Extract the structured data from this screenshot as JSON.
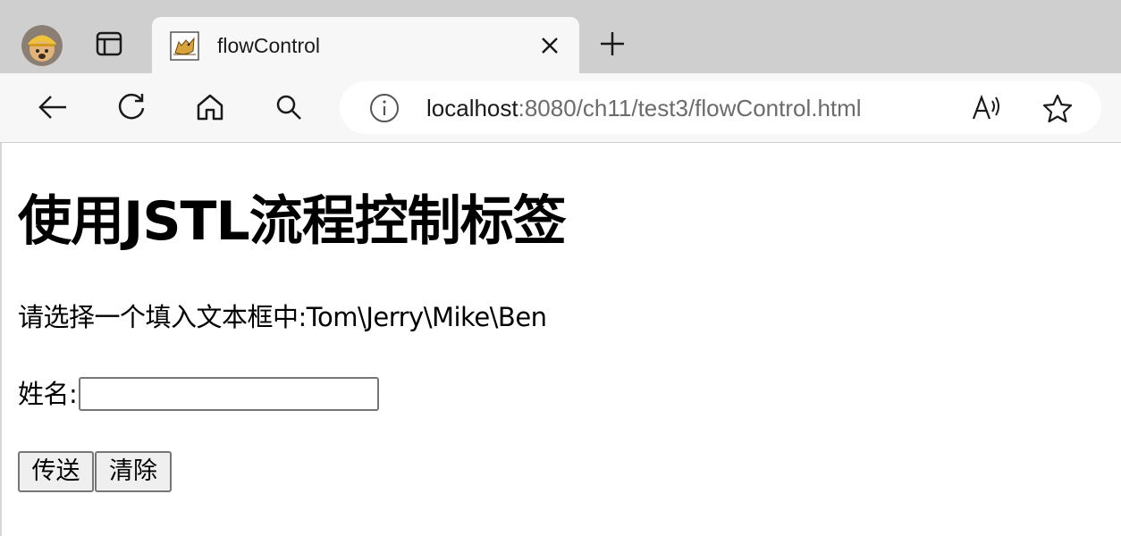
{
  "browser": {
    "tab": {
      "title": "flowControl"
    },
    "address_bar": {
      "url_host": "localhost",
      "url_path": ":8080/ch11/test3/flowControl.html"
    },
    "icons": {
      "profile": "profile-avatar",
      "tab_actions": "tab-actions-icon",
      "favicon": "tomcat-favicon",
      "close": "close-icon",
      "new_tab": "plus-icon",
      "back": "back-arrow-icon",
      "refresh": "refresh-icon",
      "home": "home-icon",
      "search": "search-icon",
      "site_info": "info-icon",
      "read_aloud": "read-aloud-icon",
      "favorite": "star-icon"
    }
  },
  "page": {
    "heading": "使用JSTL流程控制标签",
    "instruction": "请选择一个填入文本框中:Tom\\Jerry\\Mike\\Ben",
    "form": {
      "name_label": "姓名:",
      "name_value": "",
      "send_label": "传送",
      "clear_label": "清除"
    }
  }
}
